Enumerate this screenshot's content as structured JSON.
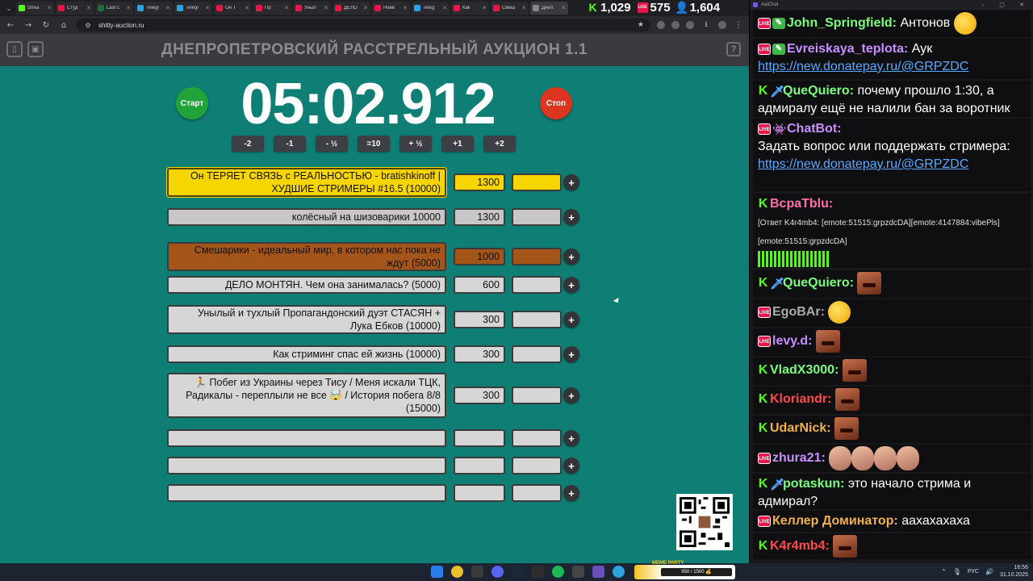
{
  "browser": {
    "tabs": [
      {
        "title": "Strea",
        "color": "#53fc18"
      },
      {
        "title": "Студ",
        "color": "#e9164d"
      },
      {
        "title": "Last c",
        "color": "#1b6d3a"
      },
      {
        "title": "Telegr",
        "color": "#2aa3e0"
      },
      {
        "title": "Telegr",
        "color": "#2aa3e0"
      },
      {
        "title": "Он Т",
        "color": "#e9164d"
      },
      {
        "title": "Пр",
        "color": "#e9164d"
      },
      {
        "title": "Уныл",
        "color": "#e9164d"
      },
      {
        "title": "ДЕЛО",
        "color": "#e9164d"
      },
      {
        "title": "Неве",
        "color": "#e9164d"
      },
      {
        "title": "Teleg",
        "color": "#2aa3e0"
      },
      {
        "title": "Как",
        "color": "#e9164d"
      },
      {
        "title": "Смеш",
        "color": "#e9164d"
      },
      {
        "title": "Днеп",
        "color": "#888888"
      }
    ],
    "url": "shitty-auction.ru"
  },
  "counters": [
    {
      "icon": "K",
      "value": "1,029",
      "color": "#53fc18"
    },
    {
      "icon": "LIVE",
      "value": "575",
      "color": "#e9164d"
    },
    {
      "icon": "👤",
      "value": "1,604",
      "color": "#3aa0ff"
    }
  ],
  "auction": {
    "title": "ДНЕПРОПЕТРОВСКИЙ РАССТРЕЛЬНЫЙ АУКЦИОН 1.1",
    "help": "?",
    "start_label": "Старт",
    "stop_label": "Стоп",
    "timer": "05:02.912",
    "adjust": [
      "-2",
      "-1",
      "- ½",
      "=10",
      "+ ½",
      "+1",
      "+2"
    ],
    "plus": "+",
    "lots": [
      {
        "name": "Он ТЕРЯЕТ СВЯЗЬ с РЕАЛЬНОСТЬЮ - bratishkinoff | ХУДШИЕ СТРИМЕРЫ #16.5 (10000)",
        "amount": "1300"
      },
      {
        "name": "колёсный на шизоварики 10000",
        "amount": "1300"
      },
      {
        "name": "Смешарики - идеальный мир, в котором нас пока не ждут (5000)",
        "amount": "1000"
      },
      {
        "name": "ДЕЛО МОНТЯН. Чем она занималась? (5000)",
        "amount": "600"
      },
      {
        "name": "Унылый и тухлый Пропагандонский дуэт СТАСЯН + Лука Ебков (10000)",
        "amount": "300"
      },
      {
        "name": "Как стриминг спас ей жизнь (10000)",
        "amount": "300"
      },
      {
        "name": "🏃 Побег из Украины через Тису / Меня искали ТЦК, Радикалы - переплыли не все 🤯 / История побега 8/8 (15000)",
        "amount": "300"
      },
      {
        "name": "",
        "amount": ""
      },
      {
        "name": "",
        "amount": ""
      },
      {
        "name": "",
        "amount": ""
      }
    ]
  },
  "chat": {
    "title": "AaiChat",
    "messages": [
      {
        "user": "John_Springfield",
        "color": "#7cfc7c",
        "text": "Антонов"
      },
      {
        "user": "Evreiskaya_teplota",
        "color": "#c890ff",
        "text": "Аук",
        "link": "https://new.donatepay.ru/@GRPZDC"
      },
      {
        "user": "QueQuiero",
        "color": "#7cfc7c",
        "text": "почему прошло 1:30, а адмиралу ещё не налили бан за воротник"
      },
      {
        "user": "ChatBot",
        "color": "#c890ff",
        "text": "Задать вопрос или поддержать стримера:",
        "link": "https://new.donatepay.ru/@GRPZDC"
      },
      {
        "user": "BcpaTblu",
        "color": "#ff6fae",
        "text": "[Ответ K4r4mb4: [emote:51515:grpzdcDA][emote:4147884:vibePls][emote:51515:grpzdcDA]"
      },
      {
        "user": "QueQuiero",
        "color": "#7cfc7c"
      },
      {
        "user": "EgoBAr",
        "color": "#aaaaaa"
      },
      {
        "user": "levy.d",
        "color": "#c890ff"
      },
      {
        "user": "VladX3000",
        "color": "#7cfc7c"
      },
      {
        "user": "Kloriandr",
        "color": "#ff4a4a"
      },
      {
        "user": "UdarNick",
        "color": "#f0b24a"
      },
      {
        "user": "zhura21",
        "color": "#c890ff"
      },
      {
        "user": "potaskun",
        "color": "#7cfc7c",
        "text": "это начало стрима и адмирал?"
      },
      {
        "user": "Келлер Доминатор",
        "color": "#f0b24a",
        "text": "аахахахаха"
      },
      {
        "user": "K4r4mb4",
        "color": "#ff4a4a"
      }
    ]
  },
  "taskbar": {
    "promo_label": "MEME PARTY",
    "promo_progress": "950 / 1500 💰",
    "lang": "РУС",
    "time": "16:56",
    "date": "31.10.2025"
  }
}
